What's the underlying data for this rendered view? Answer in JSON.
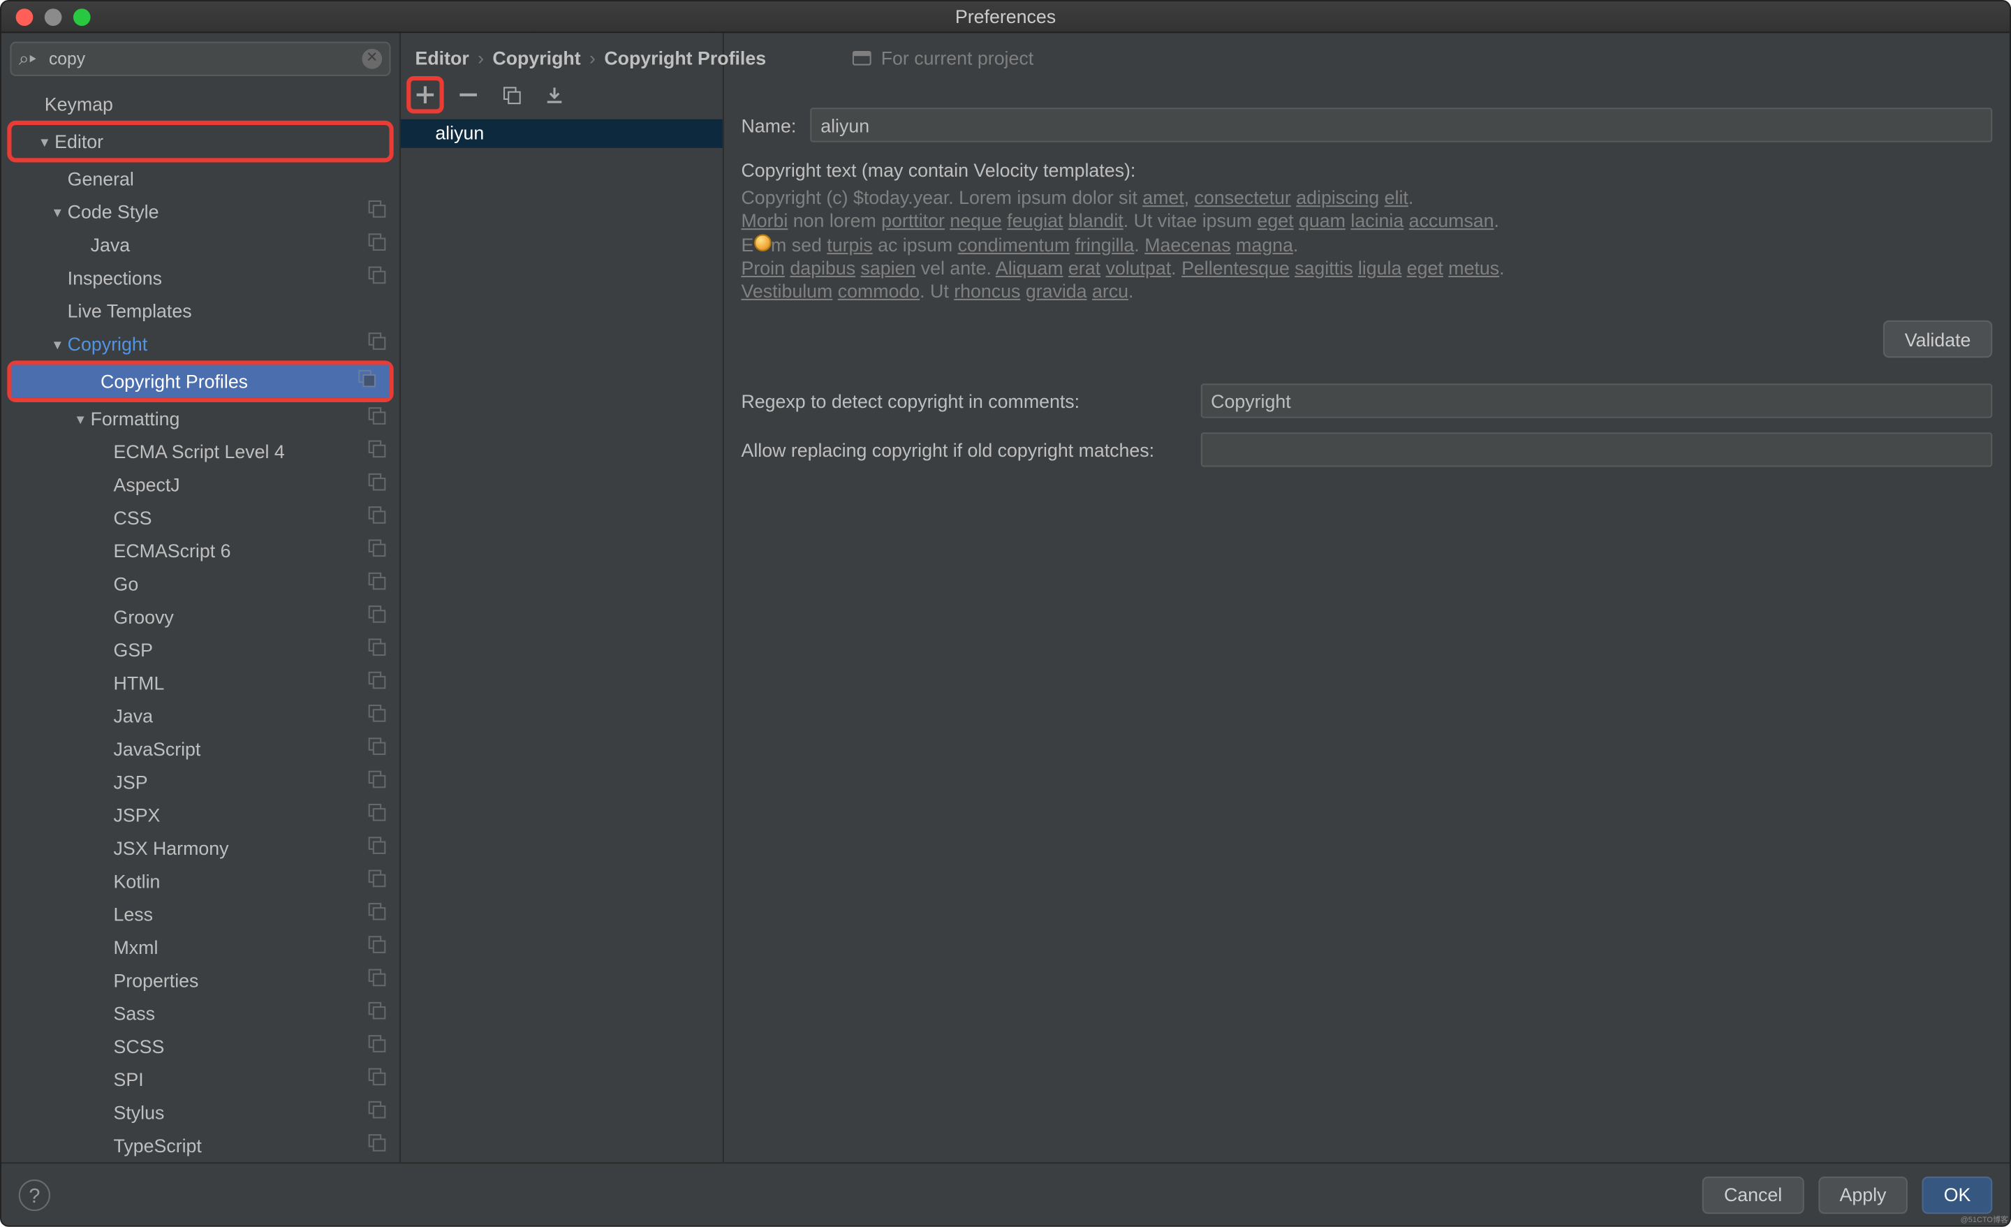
{
  "window": {
    "title": "Preferences"
  },
  "search": {
    "value": "copy"
  },
  "tree": [
    {
      "label": "Keymap",
      "indent": 30,
      "arrow": ""
    },
    {
      "label": "Editor",
      "indent": 30,
      "arrow": "▼",
      "redbox": true
    },
    {
      "label": "General",
      "indent": 46,
      "arrow": ""
    },
    {
      "label": "Code Style",
      "indent": 46,
      "arrow": "▼",
      "copy": true
    },
    {
      "label": "Java",
      "indent": 62,
      "arrow": "",
      "copy": true
    },
    {
      "label": "Inspections",
      "indent": 46,
      "arrow": "",
      "copy": true
    },
    {
      "label": "Live Templates",
      "indent": 46,
      "arrow": ""
    },
    {
      "label": "Copyright",
      "indent": 46,
      "arrow": "▼",
      "copy": true,
      "active": true
    },
    {
      "label": "Copyright Profiles",
      "indent": 62,
      "arrow": "",
      "copy": true,
      "selected": true,
      "redboxWrap": true
    },
    {
      "label": "Formatting",
      "indent": 62,
      "arrow": "▼",
      "copy": true
    },
    {
      "label": "ECMA Script Level 4",
      "indent": 78,
      "copy": true
    },
    {
      "label": "AspectJ",
      "indent": 78,
      "copy": true
    },
    {
      "label": "CSS",
      "indent": 78,
      "copy": true
    },
    {
      "label": "ECMAScript 6",
      "indent": 78,
      "copy": true
    },
    {
      "label": "Go",
      "indent": 78,
      "copy": true
    },
    {
      "label": "Groovy",
      "indent": 78,
      "copy": true
    },
    {
      "label": "GSP",
      "indent": 78,
      "copy": true
    },
    {
      "label": "HTML",
      "indent": 78,
      "copy": true
    },
    {
      "label": "Java",
      "indent": 78,
      "copy": true
    },
    {
      "label": "JavaScript",
      "indent": 78,
      "copy": true
    },
    {
      "label": "JSP",
      "indent": 78,
      "copy": true
    },
    {
      "label": "JSPX",
      "indent": 78,
      "copy": true
    },
    {
      "label": "JSX Harmony",
      "indent": 78,
      "copy": true
    },
    {
      "label": "Kotlin",
      "indent": 78,
      "copy": true
    },
    {
      "label": "Less",
      "indent": 78,
      "copy": true
    },
    {
      "label": "Mxml",
      "indent": 78,
      "copy": true
    },
    {
      "label": "Properties",
      "indent": 78,
      "copy": true
    },
    {
      "label": "Sass",
      "indent": 78,
      "copy": true
    },
    {
      "label": "SCSS",
      "indent": 78,
      "copy": true
    },
    {
      "label": "SPI",
      "indent": 78,
      "copy": true
    },
    {
      "label": "Stylus",
      "indent": 78,
      "copy": true
    },
    {
      "label": "TypeScript",
      "indent": 78,
      "copy": true
    }
  ],
  "breadcrumbs": [
    "Editor",
    "Copyright",
    "Copyright Profiles"
  ],
  "projectHint": "For current project",
  "profiles": [
    "aliyun"
  ],
  "form": {
    "nameLabel": "Name:",
    "nameValue": "aliyun",
    "textLabel": "Copyright text (may contain Velocity templates):",
    "copyrightText": "Copyright (c) $today.year. Lorem ipsum dolor sit <u>amet</u>, <u>consectetur</u> <u>adipiscing</u> <u>elit</u>.\n<u>Morbi</u> non lorem <u>porttitor</u> <u>neque</u> <u>feugiat</u> <u>blandit</u>. Ut vitae ipsum <u>eget</u> <u>quam</u> <u>lacinia</u> <u>accumsan</u>.\nE<span class='bulb'></span>m sed <u>turpis</u> ac ipsum <u>condimentum</u> <u>fringilla</u>. <u>Maecenas</u> <u>magna</u>.\n<u>Proin</u> <u>dapibus</u> <u>sapien</u> vel ante. <u>Aliquam</u> <u>erat</u> <u>volutpat</u>. <u>Pellentesque</u> <u>sagittis</u> <u>ligula</u> <u>eget</u> <u>metus</u>.\n<u>Vestibulum</u> <u>commodo</u>. Ut <u>rhoncus</u> <u>gravida</u> <u>arcu</u>.",
    "validateBtn": "Validate",
    "regexLabel": "Regexp to detect copyright in comments:",
    "regexValue": "Copyright",
    "allowLabel": "Allow replacing copyright if old copyright matches:",
    "allowValue": ""
  },
  "footer": {
    "cancel": "Cancel",
    "apply": "Apply",
    "ok": "OK"
  },
  "watermark": "@51CTO博客"
}
